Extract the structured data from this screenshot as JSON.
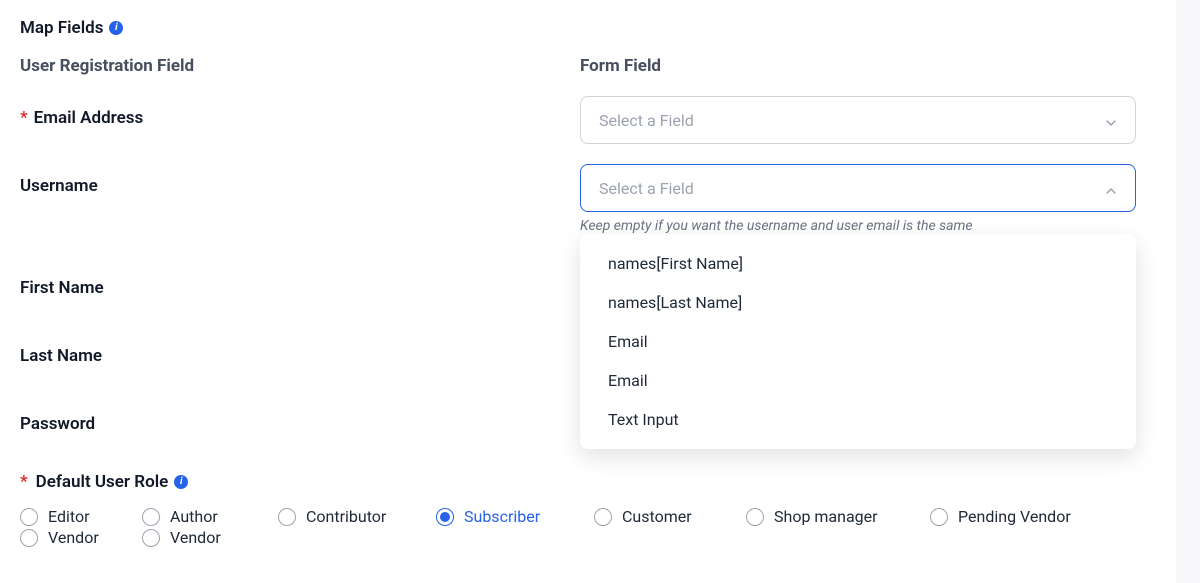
{
  "section": {
    "title": "Map Fields"
  },
  "columns": {
    "left": "User Registration Field",
    "right": "Form Field"
  },
  "fields": {
    "email": {
      "label": "Email Address",
      "required": true,
      "placeholder": "Select a Field"
    },
    "username": {
      "label": "Username",
      "required": false,
      "placeholder": "Select a Field",
      "hint": "Keep empty if you want the username and user email is the same"
    },
    "first_name": {
      "label": "First Name",
      "required": false
    },
    "last_name": {
      "label": "Last Name",
      "required": false
    },
    "password": {
      "label": "Password",
      "required": false
    }
  },
  "dropdown": {
    "options": [
      "names[First Name]",
      "names[Last Name]",
      "Email",
      "Email",
      "Text Input"
    ]
  },
  "roles": {
    "title": "Default User Role",
    "required": true,
    "selected": "Subscriber",
    "items": [
      "Editor",
      "Author",
      "Contributor",
      "Subscriber",
      "Customer",
      "Shop manager",
      "Pending Vendor",
      "Vendor",
      "Vendor"
    ]
  }
}
